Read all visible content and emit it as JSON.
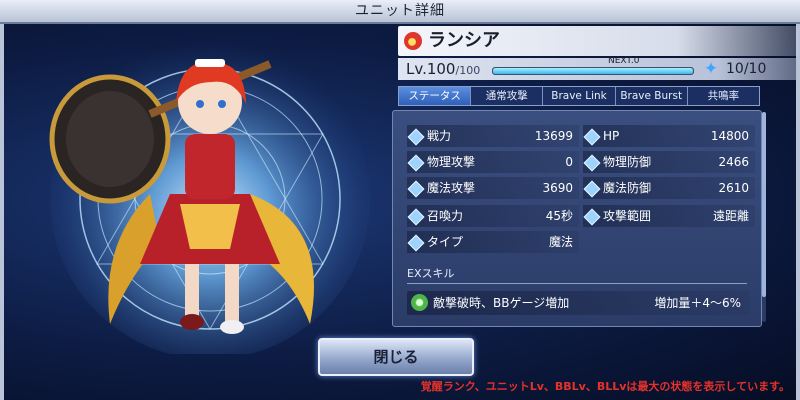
{
  "header": {
    "title": "ユニット詳細"
  },
  "unit": {
    "name": "ランシア",
    "element_icon": "fire-element-icon",
    "level_label": "Lv.",
    "level": "100",
    "level_max": "/100",
    "exp_label": "NEXT.0",
    "exp_progress": 1.0,
    "limit_break": "10/10"
  },
  "tabs": [
    {
      "label": "ステータス",
      "active": true
    },
    {
      "label": "通常攻撃",
      "active": false
    },
    {
      "label": "Brave Link",
      "active": false
    },
    {
      "label": "Brave Burst",
      "active": false
    },
    {
      "label": "共鳴率",
      "active": false
    }
  ],
  "stats": {
    "power": {
      "label": "戦力",
      "value": "13699"
    },
    "hp": {
      "label": "HP",
      "value": "14800"
    },
    "phys_atk": {
      "label": "物理攻撃",
      "value": "0"
    },
    "phys_def": {
      "label": "物理防御",
      "value": "2466"
    },
    "mag_atk": {
      "label": "魔法攻撃",
      "value": "3690"
    },
    "mag_def": {
      "label": "魔法防御",
      "value": "2610"
    },
    "summon": {
      "label": "召喚力",
      "value": "45秒"
    },
    "range": {
      "label": "攻撃範囲",
      "value": "遠距離"
    },
    "type": {
      "label": "タイプ",
      "value": "魔法"
    }
  },
  "ex_skill": {
    "header": "EXスキル",
    "name": "敵撃破時、BBゲージ増加",
    "effect": "増加量＋4～6%"
  },
  "buttons": {
    "close": "閉じる"
  },
  "notice": "覚醒ランク、ユニットLv、BBLv、BLLvは最大の状態を表示しています。",
  "colors": {
    "accent": "#3cb8ea",
    "notice": "#e5322a",
    "panel": "#2b3c68"
  }
}
